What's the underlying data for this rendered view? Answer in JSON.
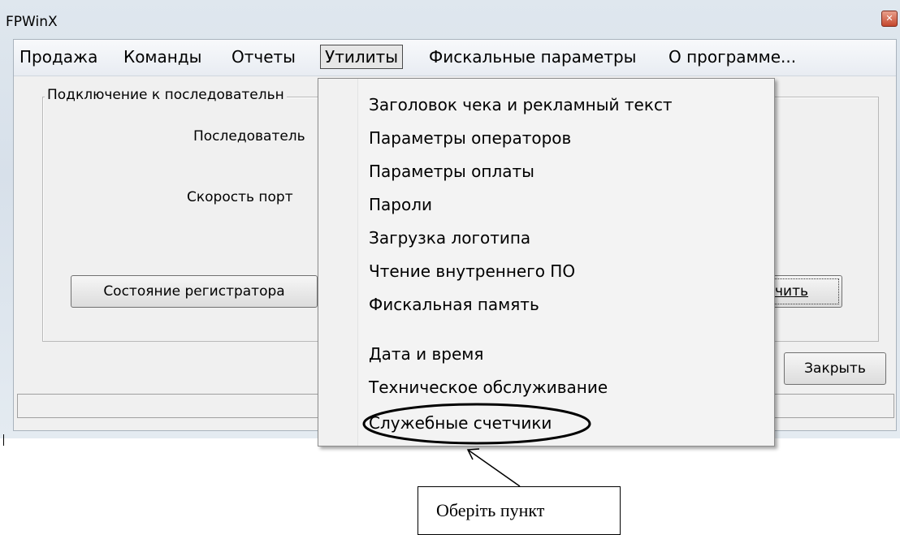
{
  "window": {
    "title": "FPWinX",
    "close_icon": "close-icon"
  },
  "menubar": {
    "items": [
      {
        "label": "Продажа"
      },
      {
        "label": "Команды"
      },
      {
        "label": "Отчеты"
      },
      {
        "label": "Утилиты",
        "active": true
      },
      {
        "label": "Фискальные параметры"
      },
      {
        "label": "О программе..."
      }
    ]
  },
  "panel": {
    "group_title": "Подключение к последовательн",
    "serial_label": "Последователь",
    "speed_label": "Скорость порт",
    "status_button": "Состояние регистратора",
    "connect_button": "чить",
    "close_button": "Закрыть"
  },
  "dropdown": {
    "items": [
      {
        "label": "Заголовок чека и рекламный текст"
      },
      {
        "label": "Параметры операторов"
      },
      {
        "label": "Параметры оплаты"
      },
      {
        "label": "Пароли"
      },
      {
        "label": "Загрузка логотипа"
      },
      {
        "label": "Чтение внутреннего ПО"
      },
      {
        "label": "Фискальная память"
      },
      {
        "label": "Дата и время"
      },
      {
        "label": "Техническое обслуживание"
      },
      {
        "label": "Служебные счетчики",
        "highlighted": true
      }
    ]
  },
  "annotation": {
    "callout_text": "Оберіть пункт"
  }
}
